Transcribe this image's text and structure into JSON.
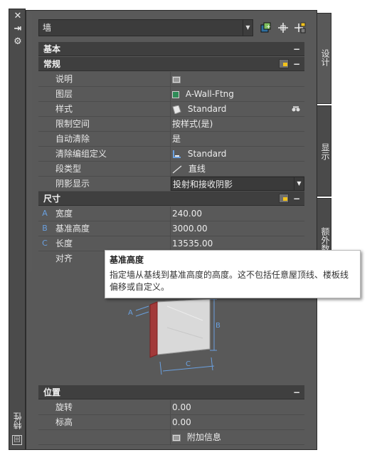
{
  "window": {
    "close_glyph": "✕",
    "dock_glyph": "⇥",
    "settings_glyph": "⚙",
    "vertical_label": "特性",
    "mini_icon_glyph": "回"
  },
  "selector": {
    "value": "墙",
    "arrow": "▼"
  },
  "toolbar": {
    "icons": [
      "toggle-pickadd-icon",
      "select-objects-icon",
      "quick-select-icon"
    ]
  },
  "sections": {
    "basic": {
      "title": "基本",
      "collapse": "−"
    },
    "general": {
      "title": "常规",
      "collapse": "−"
    },
    "dimensions": {
      "title": "尺寸",
      "collapse": "−"
    },
    "location": {
      "title": "位置",
      "collapse": "−"
    }
  },
  "general_rows": [
    {
      "label": "说明",
      "value": "",
      "icon": "description-icon"
    },
    {
      "label": "图层",
      "value": "A-Wall-Ftng",
      "icon": "layer-color-icon",
      "icon_color": "#2e8b57"
    },
    {
      "label": "样式",
      "value": "Standard",
      "icon": "style-icon"
    },
    {
      "label": "限制空间",
      "value": "按样式(是)"
    },
    {
      "label": "自动清除",
      "value": "是"
    },
    {
      "label": "清除编组定义",
      "value": "Standard",
      "icon": "cleanup-group-icon"
    },
    {
      "label": "段类型",
      "value": "直线",
      "icon": "line-segment-icon"
    },
    {
      "label": "阴影显示",
      "value": "投射和接收阴影",
      "arrow": "▼"
    }
  ],
  "dimension_rows": [
    {
      "marker": "A",
      "label": "宽度",
      "value": "240.00"
    },
    {
      "marker": "B",
      "label": "基准高度",
      "value": "3000.00"
    },
    {
      "marker": "C",
      "label": "长度",
      "value": "13535.00"
    },
    {
      "marker": "",
      "label": "对齐",
      "value": ""
    }
  ],
  "location_rows": [
    {
      "label": "旋转",
      "value": "0.00"
    },
    {
      "label": "标高",
      "value": "0.00"
    }
  ],
  "additional_info": "附加信息",
  "tooltip": {
    "title": "基准高度",
    "description": "指定墙从基线到基准高度的高度。这不包括任意屋顶线、楼板线偏移或自定义。"
  },
  "illustration": {
    "labels": [
      "A",
      "B",
      "C"
    ]
  },
  "side_tabs": [
    {
      "label": "设计"
    },
    {
      "label": "显示"
    },
    {
      "label": "额外数据"
    }
  ],
  "colors": {
    "panel_bg": "#595959",
    "header_bg": "#3f3f3f",
    "marker_blue": "#6aa0df",
    "tooltip_bg": "#ffffff"
  }
}
